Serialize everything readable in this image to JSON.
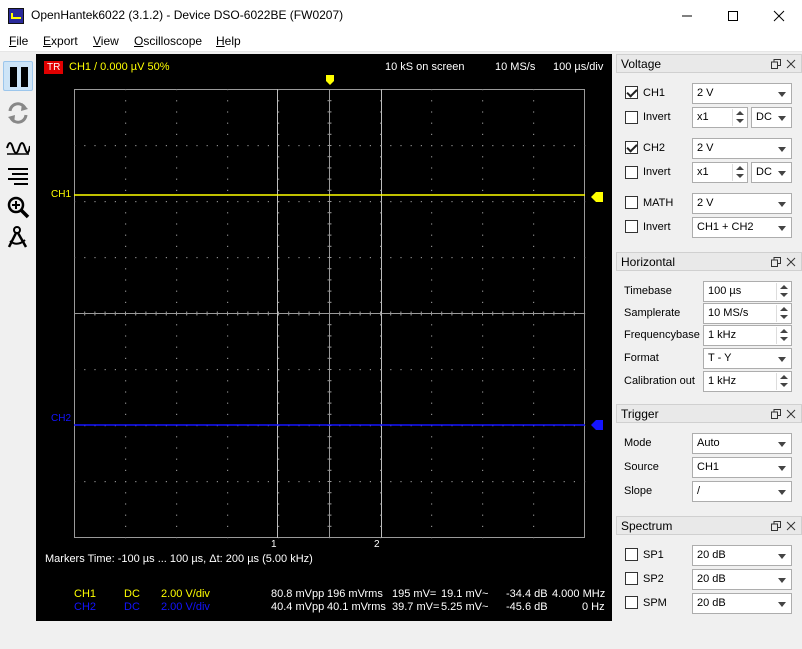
{
  "window": {
    "title": "OpenHantek6022 (3.1.2) - Device DSO-6022BE (FW0207)"
  },
  "menu": [
    {
      "label": "File",
      "u": "F",
      "rest": "ile"
    },
    {
      "label": "Export",
      "u": "E",
      "rest": "xport"
    },
    {
      "label": "View",
      "u": "V",
      "rest": "iew"
    },
    {
      "label": "Oscilloscope",
      "u": "O",
      "rest": "scilloscope"
    },
    {
      "label": "Help",
      "u": "H",
      "rest": "elp"
    }
  ],
  "toolbar": {
    "icons": [
      "pause-icon",
      "refresh-icon",
      "waveform-icon",
      "spectrum-icon",
      "zoom-icon",
      "measure-icon"
    ]
  },
  "scope": {
    "trigger_badge": "TR",
    "trigger_info": "CH1  /  0.000 µV  50%",
    "samples_on_screen": "10 kS on screen",
    "samplerate": "10 MS/s",
    "timebase": "100 µs/div",
    "ch1_label": "CH1",
    "ch2_label": "CH2",
    "marker1": "1",
    "marker2": "2",
    "markers_text": "Markers  Time: -100 µs ... 100 µs,  Δt: 200 µs (5.00 kHz)",
    "colors": {
      "ch1": "#ffff00",
      "ch2": "#1414ff",
      "grid": "#9a9a9a",
      "badge": "#e00000"
    },
    "measurements": [
      {
        "ch": "CH1",
        "coupling": "DC",
        "vdiv": "2.00 V/div",
        "vpp": "80.8 mVpp",
        "vrms": "196 mVrms",
        "dc": "195 mV=",
        "ac": "19.1 mV~",
        "db": "-34.4 dB",
        "freq": "4.000 MHz"
      },
      {
        "ch": "CH2",
        "coupling": "DC",
        "vdiv": "2.00 V/div",
        "vpp": "40.4 mVpp",
        "vrms": "40.1 mVrms",
        "dc": "39.7 mV=",
        "ac": "5.25 mV~",
        "db": "-45.6 dB",
        "freq": "0 Hz"
      }
    ]
  },
  "voltage": {
    "title": "Voltage",
    "ch1": {
      "label": "CH1",
      "checked": true,
      "gain": "2 V",
      "invert_label": "Invert",
      "probe": "x1",
      "coupling": "DC"
    },
    "ch2": {
      "label": "CH2",
      "checked": true,
      "gain": "2 V",
      "invert_label": "Invert",
      "probe": "x1",
      "coupling": "DC"
    },
    "math": {
      "label": "MATH",
      "checked": false,
      "gain": "2 V",
      "invert_label": "Invert",
      "mode": "CH1 + CH2"
    }
  },
  "horizontal": {
    "title": "Horizontal",
    "rows": [
      {
        "label": "Timebase",
        "value": "100 µs",
        "kind": "spin"
      },
      {
        "label": "Samplerate",
        "value": "10 MS/s",
        "kind": "spin"
      },
      {
        "label": "Frequencybase",
        "value": "1 kHz",
        "kind": "spin"
      },
      {
        "label": "Format",
        "value": "T - Y",
        "kind": "combo"
      },
      {
        "label": "Calibration out",
        "value": "1 kHz",
        "kind": "spin"
      }
    ]
  },
  "trigger": {
    "title": "Trigger",
    "rows": [
      {
        "label": "Mode",
        "value": "Auto"
      },
      {
        "label": "Source",
        "value": "CH1"
      },
      {
        "label": "Slope",
        "value": "/"
      }
    ]
  },
  "spectrum": {
    "title": "Spectrum",
    "rows": [
      {
        "label": "SP1",
        "value": "20 dB",
        "checked": false
      },
      {
        "label": "SP2",
        "value": "20 dB",
        "checked": false
      },
      {
        "label": "SPM",
        "value": "20 dB",
        "checked": false
      }
    ]
  }
}
